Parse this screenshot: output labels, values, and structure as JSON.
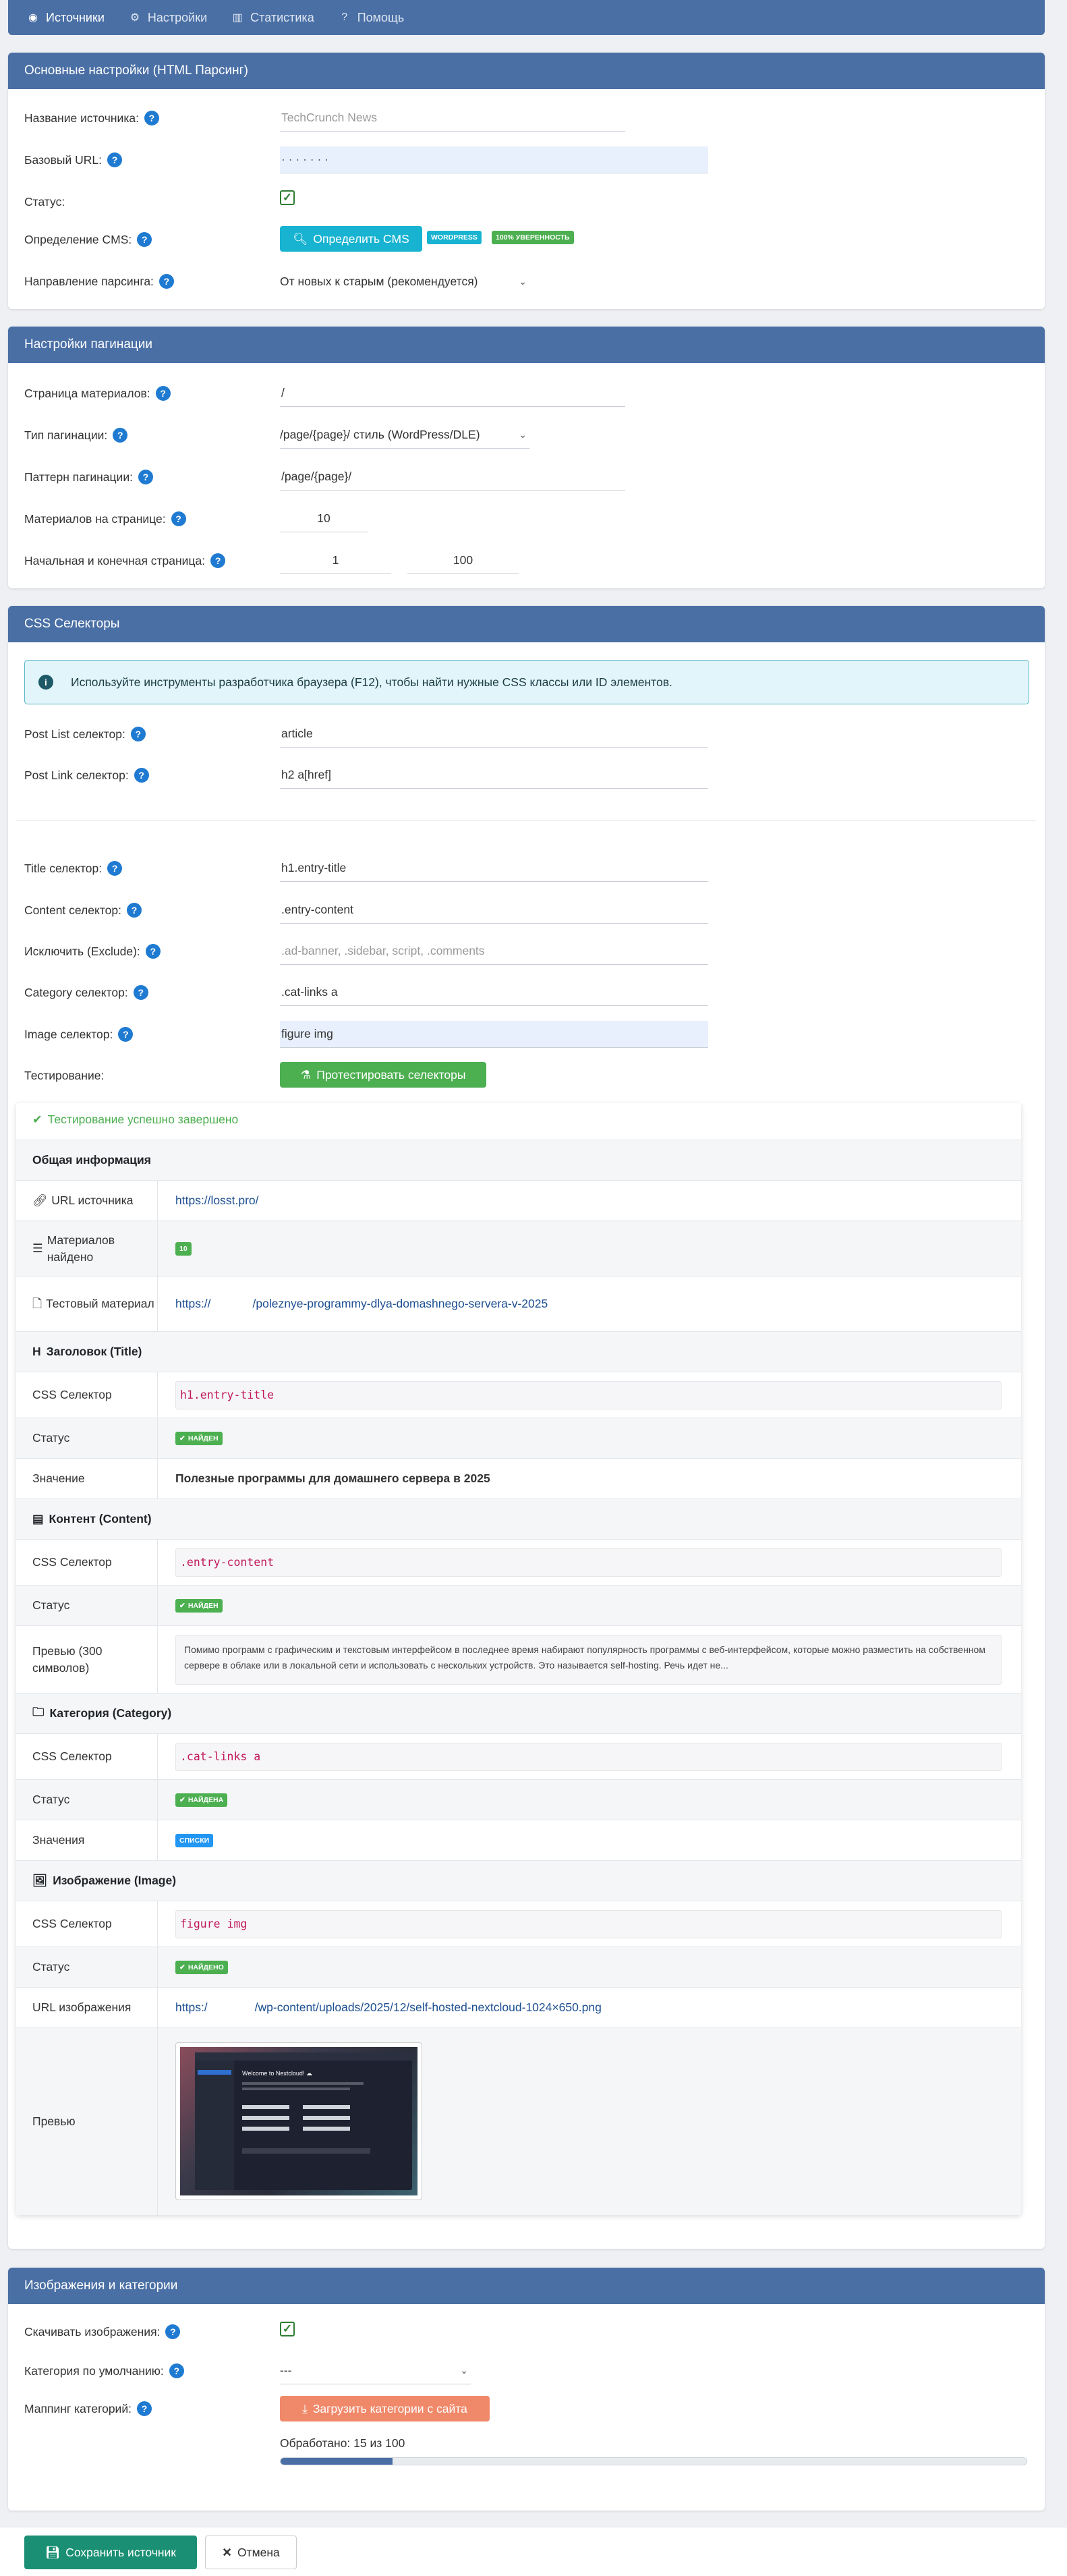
{
  "nav": {
    "items": [
      {
        "icon": "globe-icon",
        "label": "Источники"
      },
      {
        "icon": "gears-icon",
        "label": "Настройки"
      },
      {
        "icon": "chart-icon",
        "label": "Статистика"
      },
      {
        "icon": "question-icon",
        "label": "Помощь"
      }
    ]
  },
  "main": {
    "title": "Основные настройки (HTML Парсинг)",
    "name_label": "Название источника:",
    "name_placeholder": "TechCrunch News",
    "base_url_label": "Базовый URL:",
    "base_url_value": "·  ·  ·  ·  ·  ·  ·",
    "status_label": "Статус:",
    "cms_label": "Определение CMS:",
    "cms_button": "Определить CMS",
    "cms_badge": "WORDPRESS",
    "cms_conf_badge": "100% УВЕРЕННОСТЬ",
    "direction_label": "Направление парсинга:",
    "direction_value": "От новых к старым (рекомендуется)"
  },
  "pagination": {
    "title": "Настройки пагинации",
    "page_label": "Страница материалов:",
    "page_value": "/",
    "type_label": "Тип пагинации:",
    "type_value": "/page/{page}/ стиль (WordPress/DLE)",
    "pattern_label": "Паттерн пагинации:",
    "pattern_value": "/page/{page}/",
    "per_page_label": "Материалов на странице:",
    "per_page_value": "10",
    "range_label": "Начальная и конечная страница:",
    "range_start": "1",
    "range_end": "100"
  },
  "css": {
    "title": "CSS Селекторы",
    "info": "Используйте инструменты разработчика браузера (F12), чтобы найти нужные CSS классы или ID элементов.",
    "post_list_label": "Post List селектор:",
    "post_list_value": "article",
    "post_link_label": "Post Link селектор:",
    "post_link_value": "h2 a[href]",
    "title_label": "Title селектор:",
    "title_value": "h1.entry-title",
    "content_label": "Content селектор:",
    "content_value": ".entry-content",
    "exclude_label": "Исключить (Exclude):",
    "exclude_placeholder": ".ad-banner, .sidebar, script, .comments",
    "category_label": "Category селектор:",
    "category_value": ".cat-links a",
    "image_label": "Image селектор:",
    "image_value": "figure img",
    "testing_label": "Тестирование:",
    "test_button": "Протестировать селекторы"
  },
  "results": {
    "success": "Тестирование успешно завершено",
    "general_title": "Общая информация",
    "source_url_label": "URL источника",
    "source_url": "https://losst.pro/",
    "found_label": "Материалов найдено",
    "found_count": "10",
    "test_item_label": "Тестовый материал",
    "test_item_url_a": "https://",
    "test_item_url_b": "/poleznye-programmy-dlya-domashnego-servera-v-2025",
    "title_section": "Заголовок (Title)",
    "css_selector_label": "CSS Селектор",
    "status_label": "Статус",
    "title_selector": "h1.entry-title",
    "title_status": "НАЙДЕН",
    "value_label": "Значение",
    "title_value": "Полезные программы для домашнего сервера в 2025",
    "content_section": "Контент (Content)",
    "content_selector": ".entry-content",
    "content_status": "НАЙДЕН",
    "preview_label": "Превью (300 символов)",
    "content_preview": "Помимо программ с графическим и текстовым интерфейсом в последнее время набирают популярность программы с веб-интерфейсом, которые можно разместить на собственном сервере в облаке или в локальной сети и использовать с нескольких устройств. Это называется self-hosting. Речь идет не...",
    "category_section": "Категория (Category)",
    "category_selector": ".cat-links a",
    "category_status": "НАЙДЕНА",
    "values_label": "Значения",
    "category_value": "СПИСКИ",
    "image_section": "Изображение (Image)",
    "image_selector": "figure img",
    "image_status": "НАЙДЕНО",
    "image_url_label": "URL изображения",
    "image_url_a": "https:/",
    "image_url_b": "/wp-content/uploads/2025/12/self-hosted-nextcloud-1024×650.png",
    "image_preview_label": "Превью",
    "thumb_heading": "Welcome to Nextcloud! ☁"
  },
  "images": {
    "title": "Изображения и категории",
    "download_label": "Скачивать изображения:",
    "default_cat_label": "Категория по умолчанию:",
    "default_cat_value": "---",
    "mapping_label": "Маппинг категорий:",
    "load_button": "Загрузить категории с сайта",
    "progress_text": "Обработано: 15 из 100",
    "progress_fraction": 0.15
  },
  "footer": {
    "save_button": "Сохранить источник",
    "cancel_button": "Отмена"
  },
  "colors": {
    "header": "#4a6fa5",
    "success": "#4caf50",
    "info": "#17b3d1",
    "primary": "#1f7ad1",
    "warning_btn": "#f0896a",
    "save_btn": "#1a8f73"
  }
}
